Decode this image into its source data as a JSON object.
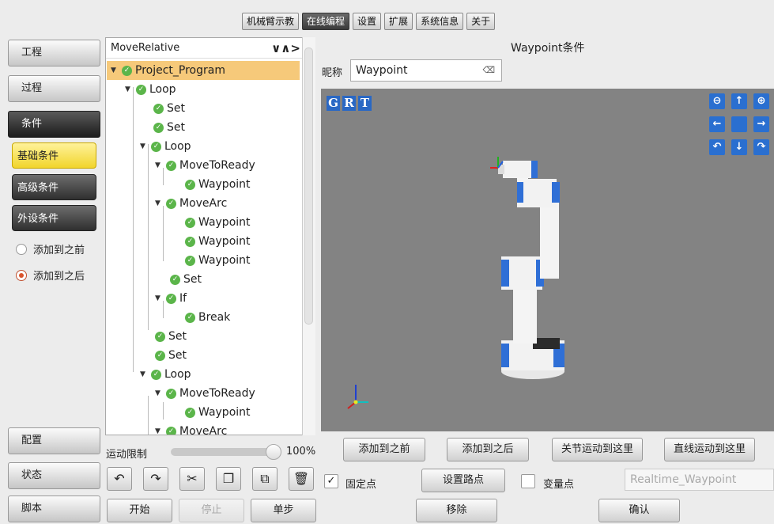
{
  "top_tabs": [
    "机械臂示教",
    "在线编程",
    "设置",
    "扩展",
    "系统信息",
    "关于"
  ],
  "nav": {
    "project": "工程",
    "process": "过程",
    "condition": "条件",
    "config": "配置",
    "status": "状态",
    "script": "脚本"
  },
  "condition_sub": {
    "basic": "基础条件",
    "advanced": "高级条件",
    "peripheral": "外设条件"
  },
  "radios": {
    "before": "添加到之前",
    "after": "添加到之后"
  },
  "tree": {
    "header": "MoveRelative",
    "nav_arrows": "∨∧>",
    "nodes": [
      "Project_Program",
      "Loop",
      "Set",
      "Set",
      "Loop",
      "MoveToReady",
      "Waypoint",
      "MoveArc",
      "Waypoint",
      "Waypoint",
      "Waypoint",
      "Set",
      "If",
      "Break",
      "Set",
      "Set",
      "Loop",
      "MoveToReady",
      "Waypoint",
      "MoveArc"
    ]
  },
  "motion": {
    "label": "运动限制",
    "value": "100%"
  },
  "tools": [
    "↶",
    "↷",
    "✂",
    "❐",
    "⧉",
    "🗑"
  ],
  "run": {
    "start": "开始",
    "stop": "停止",
    "step": "单步"
  },
  "panel": {
    "title": "Waypoint条件",
    "nickname_label": "昵称",
    "nickname_value": "Waypoint",
    "clear_icon": "⌫"
  },
  "viewer_labels": {
    "g": "G",
    "r": "R",
    "t": "T"
  },
  "viewer_controls": [
    "⊖",
    "↑",
    "⊕",
    "←",
    "",
    "→",
    "↶",
    "↓",
    "↷"
  ],
  "actions": {
    "add_before": "添加到之前",
    "add_after": "添加到之后",
    "joint_move": "关节运动到这里",
    "linear_move": "直线运动到这里",
    "fixed_point_label": "固定点",
    "set_waypoint": "设置路点",
    "variable_point_label": "变量点",
    "variable_select": "Realtime_Waypoint",
    "remove": "移除",
    "confirm": "确认"
  }
}
